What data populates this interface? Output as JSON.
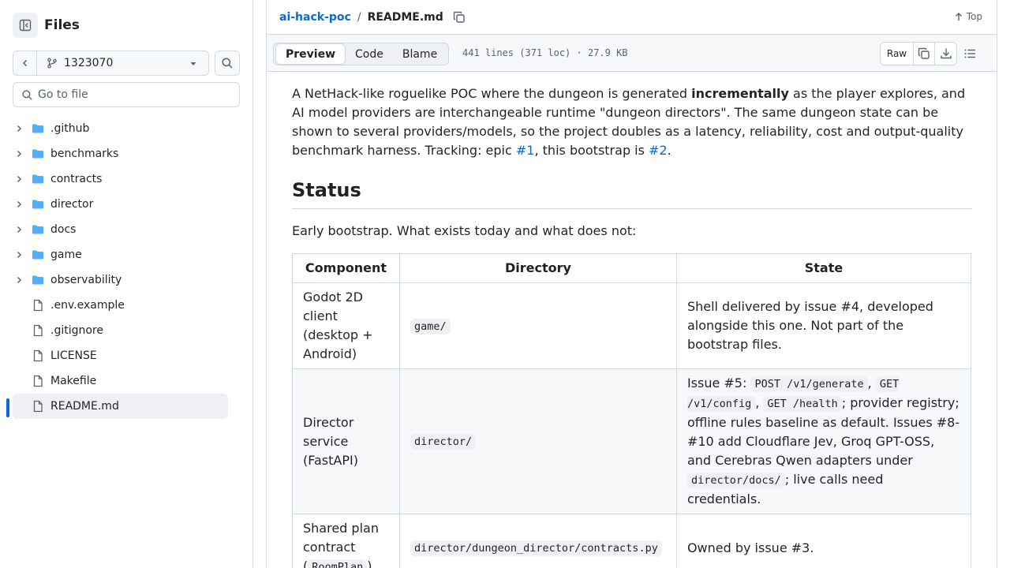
{
  "sidebar": {
    "title": "Files",
    "branch": "1323070",
    "goto_placeholder": "Go to file",
    "items": [
      {
        "type": "folder",
        "name": ".github"
      },
      {
        "type": "folder",
        "name": "benchmarks"
      },
      {
        "type": "folder",
        "name": "contracts"
      },
      {
        "type": "folder",
        "name": "director"
      },
      {
        "type": "folder",
        "name": "docs"
      },
      {
        "type": "folder",
        "name": "game"
      },
      {
        "type": "folder",
        "name": "observability"
      },
      {
        "type": "file",
        "name": ".env.example"
      },
      {
        "type": "file",
        "name": ".gitignore"
      },
      {
        "type": "file",
        "name": "LICENSE"
      },
      {
        "type": "file",
        "name": "Makefile"
      },
      {
        "type": "file",
        "name": "README.md",
        "selected": true
      }
    ]
  },
  "header": {
    "repo": "ai-hack-poc",
    "separator": "/",
    "file": "README.md",
    "top_label": "Top"
  },
  "filebar": {
    "tabs": [
      "Preview",
      "Code",
      "Blame"
    ],
    "active_tab": "Preview",
    "meta": "441 lines (371 loc) · 27.9 KB",
    "raw_label": "Raw"
  },
  "readme": {
    "intro_p1": "A NetHack-like roguelike POC where the dungeon is generated ",
    "intro_bold": "incrementally",
    "intro_p2": " as the player explores, and AI model providers are interchangeable runtime \"dungeon directors\". The same dungeon state can be shown to several providers/models, so the project doubles as a latency, reliability, cost and output-quality benchmark harness. Tracking: epic ",
    "link1": "#1",
    "intro_p3": ", this bootstrap is ",
    "link2": "#2",
    "intro_p4": ".",
    "status_heading": "Status",
    "status_intro": "Early bootstrap. What exists today and what does not:",
    "table": {
      "headers": [
        "Component",
        "Directory",
        "State"
      ],
      "row1": {
        "component": "Godot 2D client (desktop + Android)",
        "directory": "game/",
        "state": "Shell delivered by issue #4, developed alongside this one. Not part of the bootstrap files."
      },
      "row2": {
        "component": "Director service (FastAPI)",
        "directory": "director/",
        "s1": "Issue #5: ",
        "c1": "POST /v1/generate",
        "s2": ", ",
        "c2": "GET /v1/config",
        "s3": ", ",
        "c3": "GET /health",
        "s4": "; provider registry; offline rules baseline as default. Issues #8-#10 add Cloudflare Jev, Groq GPT-OSS, and Cerebras Qwen adapters under ",
        "c4": "director/docs/",
        "s5": "; live calls need credentials."
      },
      "row3": {
        "component_pre": "Shared plan contract (",
        "component_code": "RoomPlan",
        "component_post": ")",
        "directory": "director/dungeon_director/contracts.py",
        "state": "Owned by issue #3."
      }
    }
  }
}
